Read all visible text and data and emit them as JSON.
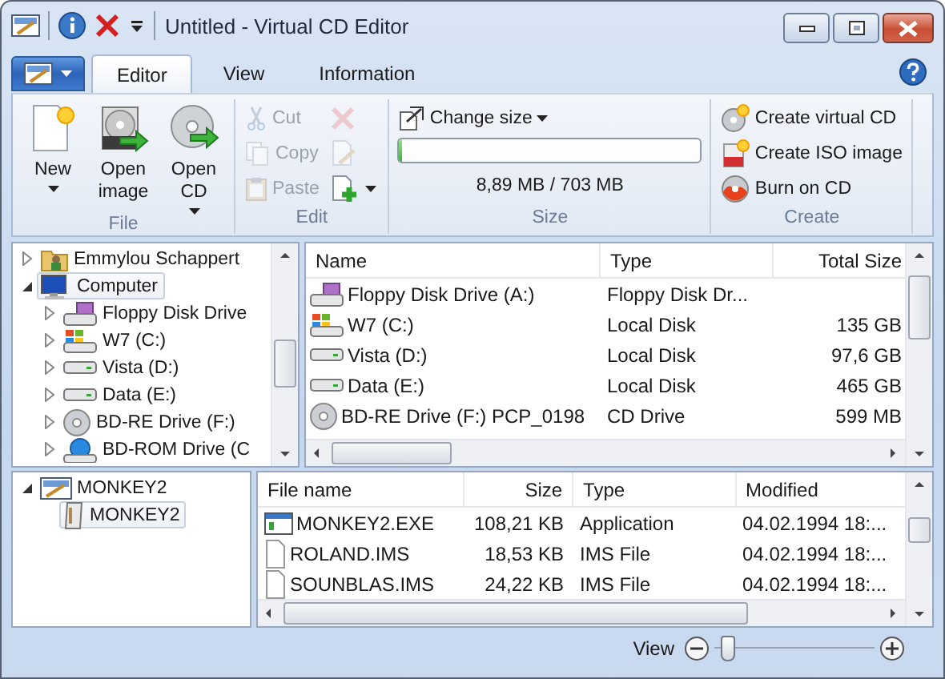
{
  "window": {
    "title": "Untitled - Virtual CD Editor"
  },
  "tabs": [
    {
      "label": "Editor",
      "selected": true
    },
    {
      "label": "View",
      "selected": false
    },
    {
      "label": "Information",
      "selected": false
    }
  ],
  "ribbon": {
    "groups": [
      {
        "label": "File",
        "kind": "large",
        "buttons": [
          {
            "label": "New",
            "dropdown": true,
            "disabled": false
          },
          {
            "label": "Open image",
            "dropdown": false,
            "disabled": false
          },
          {
            "label": "Open CD",
            "dropdown": true,
            "disabled": false
          }
        ]
      },
      {
        "label": "Edit",
        "kind": "small",
        "buttons": [
          {
            "label": "Cut",
            "dropdown": false,
            "disabled": true
          },
          {
            "label": "Copy",
            "dropdown": false,
            "disabled": true
          },
          {
            "label": "Paste",
            "dropdown": false,
            "disabled": true
          }
        ],
        "icon_buttons": [
          {
            "dropdown": false,
            "disabled": true
          },
          {
            "dropdown": false,
            "disabled": true
          },
          {
            "dropdown": true,
            "disabled": false
          }
        ]
      },
      {
        "label": "Size",
        "kind": "size",
        "buttons": [
          {
            "label": "Change size",
            "dropdown": true,
            "disabled": false
          }
        ],
        "level": 0.01,
        "reading": "8,89 MB / 703 MB"
      },
      {
        "label": "Create",
        "kind": "small",
        "buttons": [
          {
            "label": "Create virtual CD",
            "dropdown": false,
            "disabled": false
          },
          {
            "label": "Create ISO image",
            "dropdown": false,
            "disabled": false
          },
          {
            "label": "Burn on CD",
            "dropdown": false,
            "disabled": false
          }
        ]
      }
    ]
  },
  "drive_tree": {
    "items": [
      {
        "label": "Emmylou Schappert",
        "kind": "user",
        "expanded": false,
        "selected": false
      },
      {
        "label": "Computer",
        "kind": "computer",
        "expanded": true,
        "selected": true,
        "children": [
          {
            "label": "Floppy Disk Drive",
            "kind": "floppy",
            "expanded": false,
            "selected": false
          },
          {
            "label": "W7 (C:)",
            "kind": "system",
            "expanded": false,
            "selected": false
          },
          {
            "label": "Vista (D:)",
            "kind": "disk",
            "expanded": false,
            "selected": false
          },
          {
            "label": "Data (E:)",
            "kind": "disk",
            "expanded": false,
            "selected": false
          },
          {
            "label": "BD-RE Drive (F:)",
            "kind": "optical",
            "expanded": false,
            "selected": false
          },
          {
            "label": "BD-ROM Drive (C",
            "kind": "globe",
            "expanded": false,
            "selected": false
          }
        ]
      }
    ]
  },
  "drive_list": {
    "columns": [
      "Name",
      "Type",
      "Total Size"
    ],
    "rows": [
      {
        "kind": "floppy",
        "cells": [
          "Floppy Disk Drive (A:)",
          "Floppy Disk Dr...",
          ""
        ]
      },
      {
        "kind": "system",
        "cells": [
          "W7 (C:)",
          "Local Disk",
          "135 GB"
        ]
      },
      {
        "kind": "disk",
        "cells": [
          "Vista (D:)",
          "Local Disk",
          "97,6 GB"
        ]
      },
      {
        "kind": "disk",
        "cells": [
          "Data (E:)",
          "Local Disk",
          "465 GB"
        ]
      },
      {
        "kind": "optical",
        "cells": [
          "BD-RE Drive (F:) PCP_0198",
          "CD Drive",
          "599 MB"
        ]
      }
    ]
  },
  "image_tree": {
    "items": [
      {
        "label": "MONKEY2",
        "kind": "image",
        "expanded": true,
        "selected": false,
        "children": [
          {
            "label": "MONKEY2",
            "kind": "folder",
            "selected": true
          }
        ]
      }
    ]
  },
  "file_list": {
    "columns": [
      "File name",
      "Size",
      "Type",
      "Modified"
    ],
    "rows": [
      {
        "kind": "application",
        "cells": [
          "MONKEY2.EXE",
          "108,21 KB",
          "Application",
          "04.02.1994 18:..."
        ]
      },
      {
        "kind": "file",
        "cells": [
          "ROLAND.IMS",
          "18,53 KB",
          "IMS File",
          "04.02.1994 18:..."
        ]
      },
      {
        "kind": "file",
        "cells": [
          "SOUNBLAS.IMS",
          "24,22 KB",
          "IMS File",
          "04.02.1994 18:..."
        ]
      }
    ]
  },
  "status_bar": {
    "label": "View",
    "zoom": {
      "level": 0.05
    }
  }
}
